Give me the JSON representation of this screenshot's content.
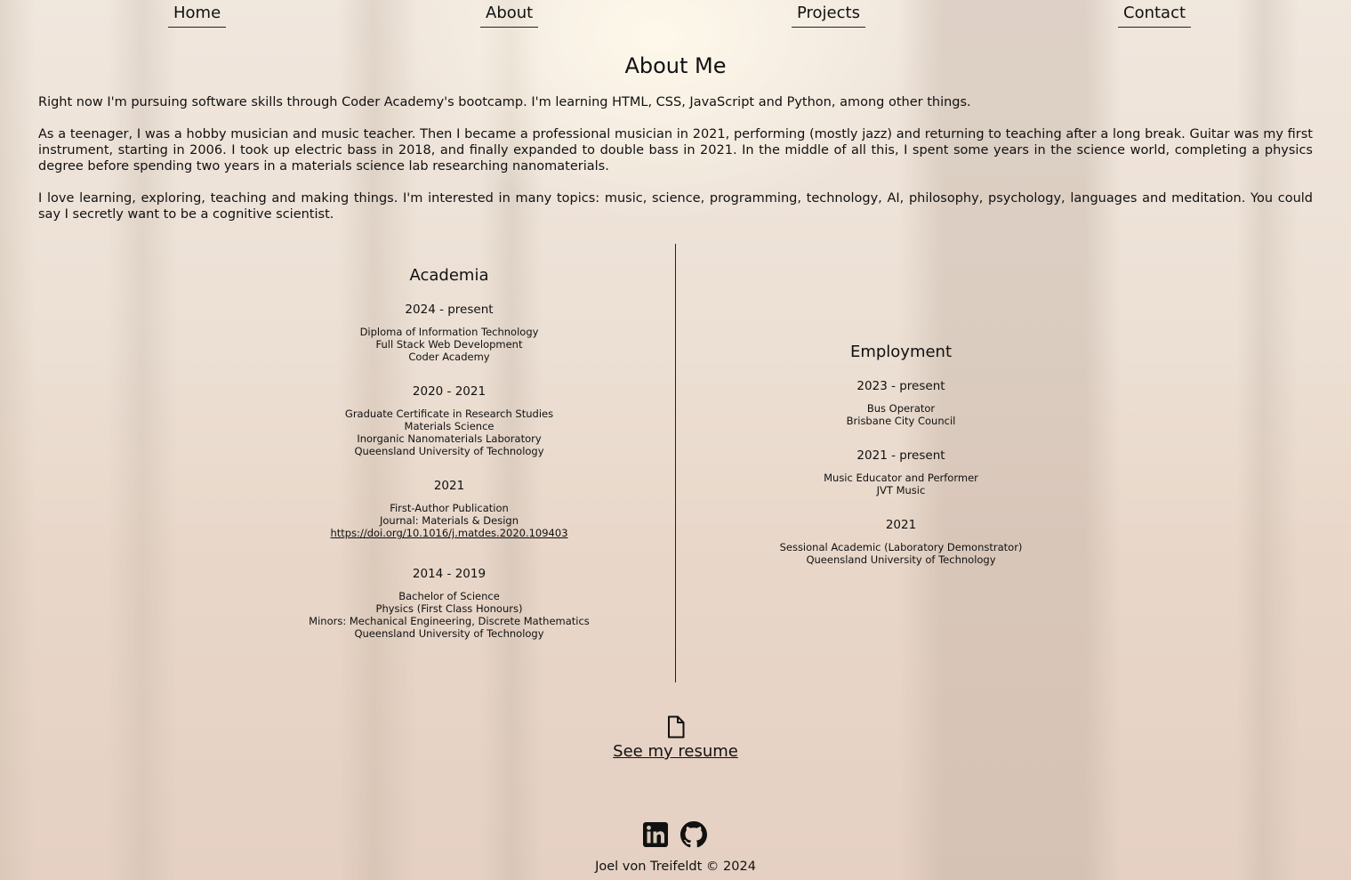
{
  "nav": {
    "home": "Home",
    "about": "About",
    "projects": "Projects",
    "contact": "Contact"
  },
  "page_title": "About Me",
  "intro": [
    "Right now I'm pursuing software skills through Coder Academy's bootcamp. I'm learning HTML, CSS, JavaScript and Python, among other things.",
    "As a teenager, I was a hobby musician and music teacher. Then I became a professional musician in 2021, performing (mostly jazz) and returning to teaching after a long break. Guitar was my first instrument, starting in 2006. I took up electric bass in 2018, and finally expanded to double bass in 2021. In the middle of all this, I spent some years in the science world, completing a physics degree before spending two years in a materials science lab researching nanomaterials.",
    "I love learning, exploring, teaching and making things. I'm interested in many topics: music, science, programming, technology, AI, philosophy, psychology, languages and meditation. You could say I secretly want to be a cognitive scientist."
  ],
  "academia": {
    "heading": "Academia",
    "entries": [
      {
        "date": "2024 - present",
        "lines": [
          "Diploma of Information Technology",
          "Full Stack Web Development",
          "Coder Academy"
        ]
      },
      {
        "date": "2020 - 2021",
        "lines": [
          "Graduate Certificate in Research Studies",
          "Materials Science",
          "Inorganic Nanomaterials Laboratory",
          "Queensland University of Technology"
        ]
      },
      {
        "date": "2021",
        "lines": [
          "First-Author Publication",
          "Journal: Materials & Design"
        ],
        "link": "https://doi.org/10.1016/j.matdes.2020.109403"
      },
      {
        "date": "2014 - 2019",
        "lines": [
          "Bachelor of Science",
          "Physics (First Class Honours)",
          "Minors: Mechanical Engineering, Discrete Mathematics",
          "Queensland University of Technology"
        ]
      }
    ]
  },
  "employment": {
    "heading": "Employment",
    "entries": [
      {
        "date": "2023 - present",
        "lines": [
          "Bus Operator",
          "Brisbane City Council"
        ]
      },
      {
        "date": "2021 - present",
        "lines": [
          "Music Educator and Performer",
          "JVT Music"
        ]
      },
      {
        "date": "2021",
        "lines": [
          "Sessional Academic (Laboratory Demonstrator)",
          "Queensland University of Technology"
        ]
      }
    ]
  },
  "resume": {
    "icon": "file-icon",
    "label": "See my resume"
  },
  "social": {
    "linkedin_icon": "linkedin-icon",
    "github_icon": "github-icon"
  },
  "footer": "Joel von Treifeldt © 2024"
}
